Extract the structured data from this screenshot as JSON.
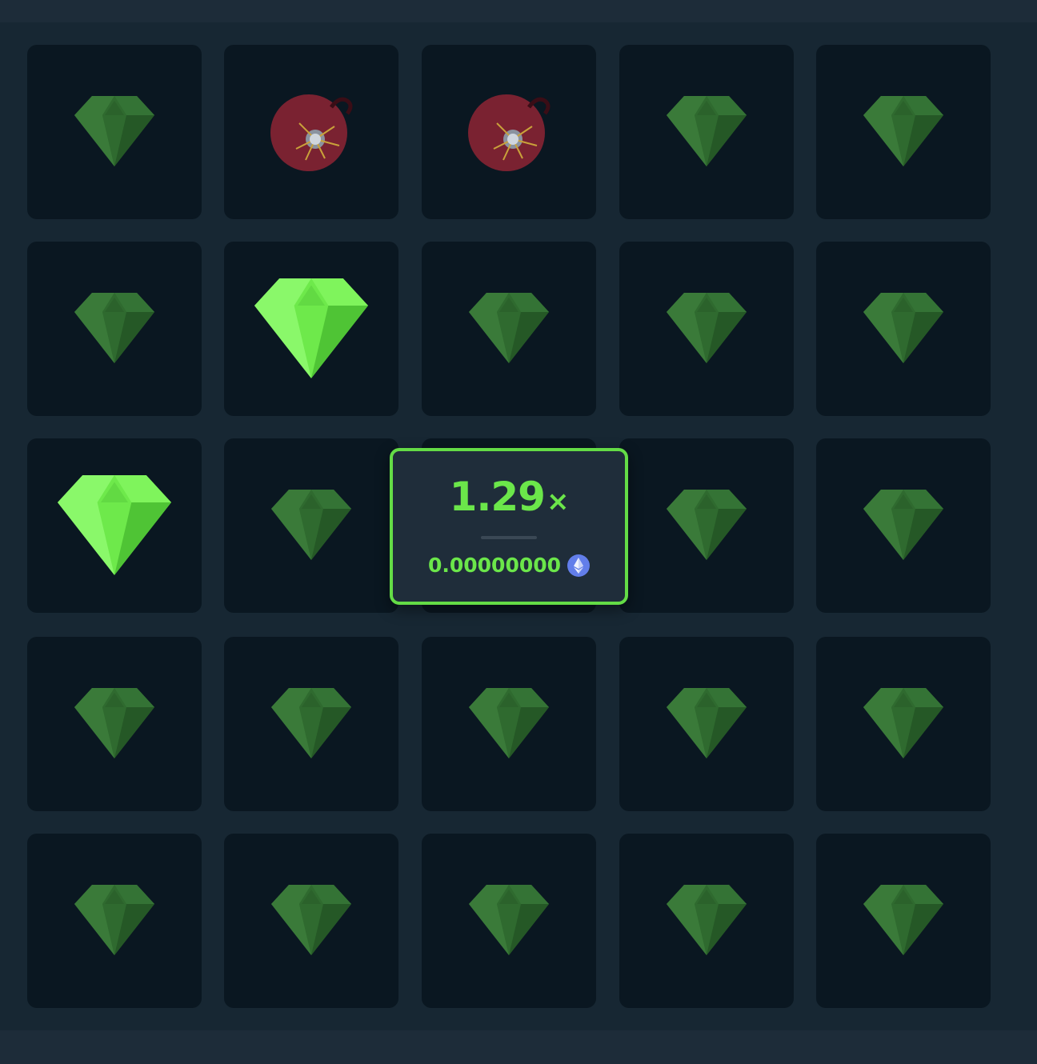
{
  "game": {
    "grid": [
      [
        "gem-dim",
        "mine",
        "mine",
        "gem-dim",
        "gem-dim"
      ],
      [
        "gem-dim",
        "gem-revealed",
        "gem-dim",
        "gem-dim",
        "gem-dim"
      ],
      [
        "gem-revealed",
        "gem-dim",
        "gem-dim",
        "gem-dim",
        "gem-dim"
      ],
      [
        "gem-dim",
        "gem-dim",
        "gem-dim",
        "gem-dim",
        "gem-dim"
      ],
      [
        "gem-dim",
        "gem-dim",
        "gem-dim",
        "gem-dim",
        "gem-dim"
      ]
    ]
  },
  "payout": {
    "multiplier": "1.29",
    "multiplier_suffix": "×",
    "amount": "0.00000000",
    "currency_icon": "ethereum-icon"
  },
  "colors": {
    "background": "#0f212e",
    "tile": "#0a1721",
    "accent_green": "#6be64a",
    "gem_bright": "#6ee94b",
    "gem_dim": "#2f6a2f",
    "mine": "#7a2231",
    "ethereum": "#627eea"
  }
}
